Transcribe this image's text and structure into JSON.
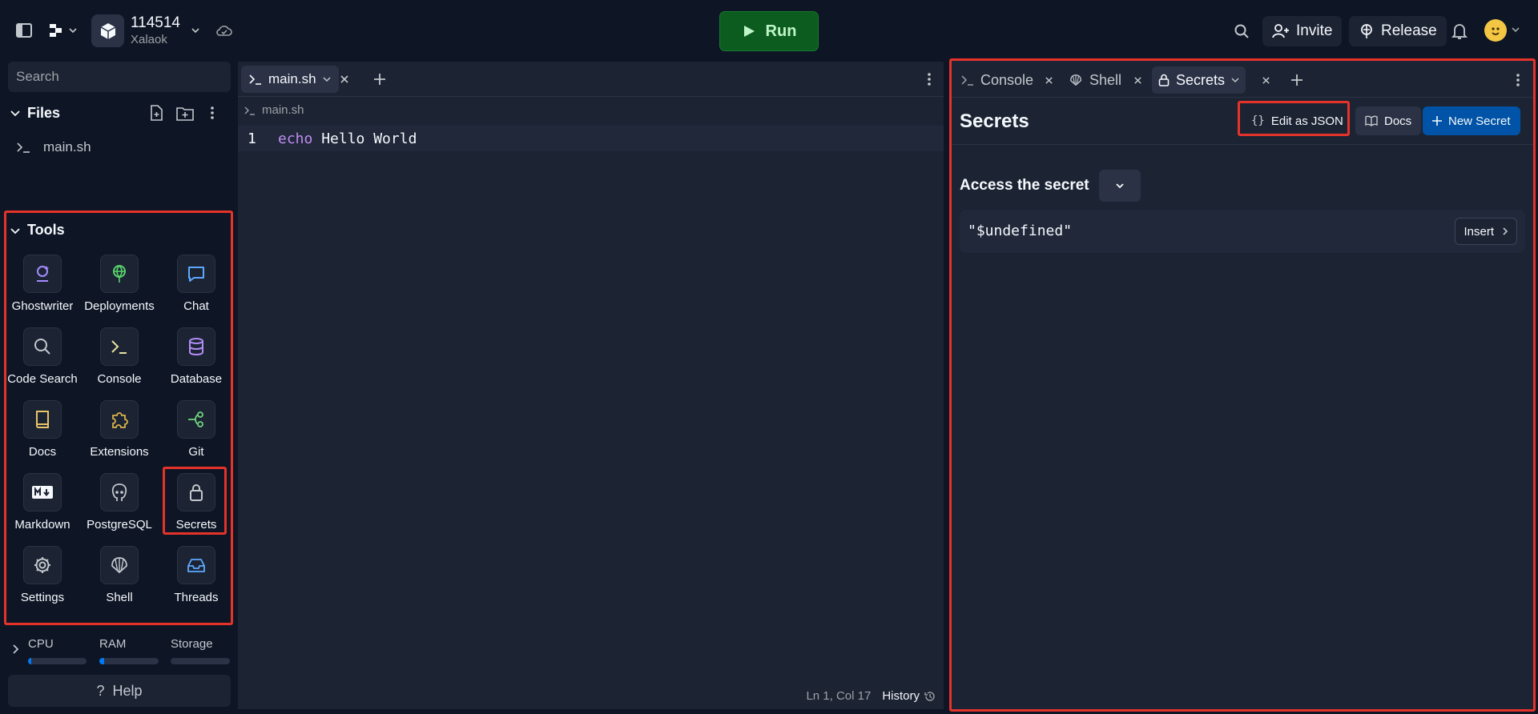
{
  "topbar": {
    "repl_name": "114514",
    "repl_owner": "Xalaok",
    "run_label": "Run",
    "invite_label": "Invite",
    "release_label": "Release"
  },
  "sidebar": {
    "search_placeholder": "Search",
    "files_heading": "Files",
    "files": [
      {
        "name": "main.sh"
      }
    ],
    "tools_heading": "Tools",
    "tools": [
      {
        "label": "Ghostwriter",
        "icon": "ghostwriter-icon"
      },
      {
        "label": "Deployments",
        "icon": "deployments-icon"
      },
      {
        "label": "Chat",
        "icon": "chat-icon"
      },
      {
        "label": "Code Search",
        "icon": "search-icon"
      },
      {
        "label": "Console",
        "icon": "terminal-icon"
      },
      {
        "label": "Database",
        "icon": "database-icon"
      },
      {
        "label": "Docs",
        "icon": "book-icon"
      },
      {
        "label": "Extensions",
        "icon": "puzzle-icon"
      },
      {
        "label": "Git",
        "icon": "git-icon"
      },
      {
        "label": "Markdown",
        "icon": "markdown-icon"
      },
      {
        "label": "PostgreSQL",
        "icon": "postgresql-icon"
      },
      {
        "label": "Secrets",
        "icon": "lock-icon"
      },
      {
        "label": "Settings",
        "icon": "gear-icon"
      },
      {
        "label": "Shell",
        "icon": "shell-icon"
      },
      {
        "label": "Threads",
        "icon": "inbox-icon"
      }
    ],
    "resources": [
      {
        "label": "CPU",
        "usage": 0.05
      },
      {
        "label": "RAM",
        "usage": 0.08
      },
      {
        "label": "Storage",
        "usage": 0.0
      }
    ],
    "help_label": "Help"
  },
  "editor": {
    "tab_label": "main.sh",
    "breadcrumb": "main.sh",
    "line_number": "1",
    "code_keyword": "echo",
    "code_rest": " Hello World",
    "cursor_position": "Ln 1, Col 17",
    "history_label": "History"
  },
  "right_pane": {
    "tabs": [
      {
        "label": "Console",
        "icon": "terminal-icon"
      },
      {
        "label": "Shell",
        "icon": "shell-icon"
      },
      {
        "label": "Secrets",
        "icon": "lock-icon",
        "active": true
      }
    ],
    "title": "Secrets",
    "edit_json_label": "Edit as JSON",
    "docs_label": "Docs",
    "new_secret_label": "New Secret",
    "access_heading": "Access the secret",
    "secret_snippet": "\"$undefined\"",
    "insert_label": "Insert"
  },
  "colors": {
    "background": "#0e1525",
    "surface": "#1c2333",
    "accent_blue": "#0053a6",
    "run_green": "#0b5c1e",
    "highlight_red": "#e5332a"
  }
}
